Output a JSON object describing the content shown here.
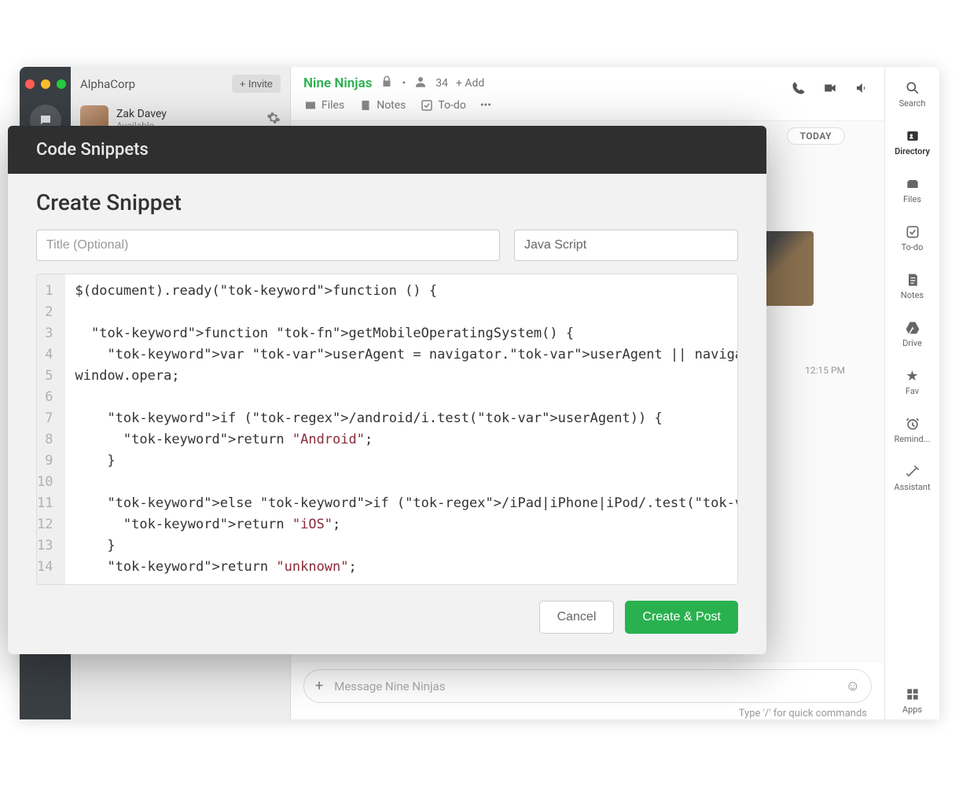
{
  "org": {
    "name": "AlphaCorp",
    "invite_label": "+ Invite"
  },
  "user": {
    "name": "Zak Davey",
    "status": "Available"
  },
  "channel": {
    "name": "Nine Ninjas",
    "member_count": "34",
    "add_label": "+ Add",
    "tabs": {
      "files": "Files",
      "notes": "Notes",
      "todo": "To-do"
    }
  },
  "chat": {
    "today_label": "TODAY",
    "timestamp": "12:15 PM",
    "compose_placeholder": "Message Nine Ninjas",
    "hint": "Type '/' for quick commands"
  },
  "right_rail": {
    "search": "Search",
    "directory": "Directory",
    "files": "Files",
    "todo": "To-do",
    "notes": "Notes",
    "drive": "Drive",
    "fav": "Fav",
    "remind": "Remind...",
    "assistant": "Assistant",
    "apps": "Apps"
  },
  "modal": {
    "header": "Code Snippets",
    "subtitle": "Create Snippet",
    "title_placeholder": "Title (Optional)",
    "language_value": "Java Script",
    "code_lines": [
      "$(document).ready(function () {",
      "",
      "  function getMobileOperatingSystem() {",
      "    var userAgent = navigator.userAgent || navigator.vendor ||",
      "window.opera;",
      "",
      "    if (/android/i.test(userAgent)) {",
      "      return \"Android\";",
      "    }",
      "",
      "    else if (/iPad|iPhone|iPod/.test(userAgent) && !window.MSStream) {",
      "      return \"iOS\";",
      "    }",
      "    return \"unknown\";"
    ],
    "cancel_label": "Cancel",
    "create_label": "Create & Post"
  }
}
